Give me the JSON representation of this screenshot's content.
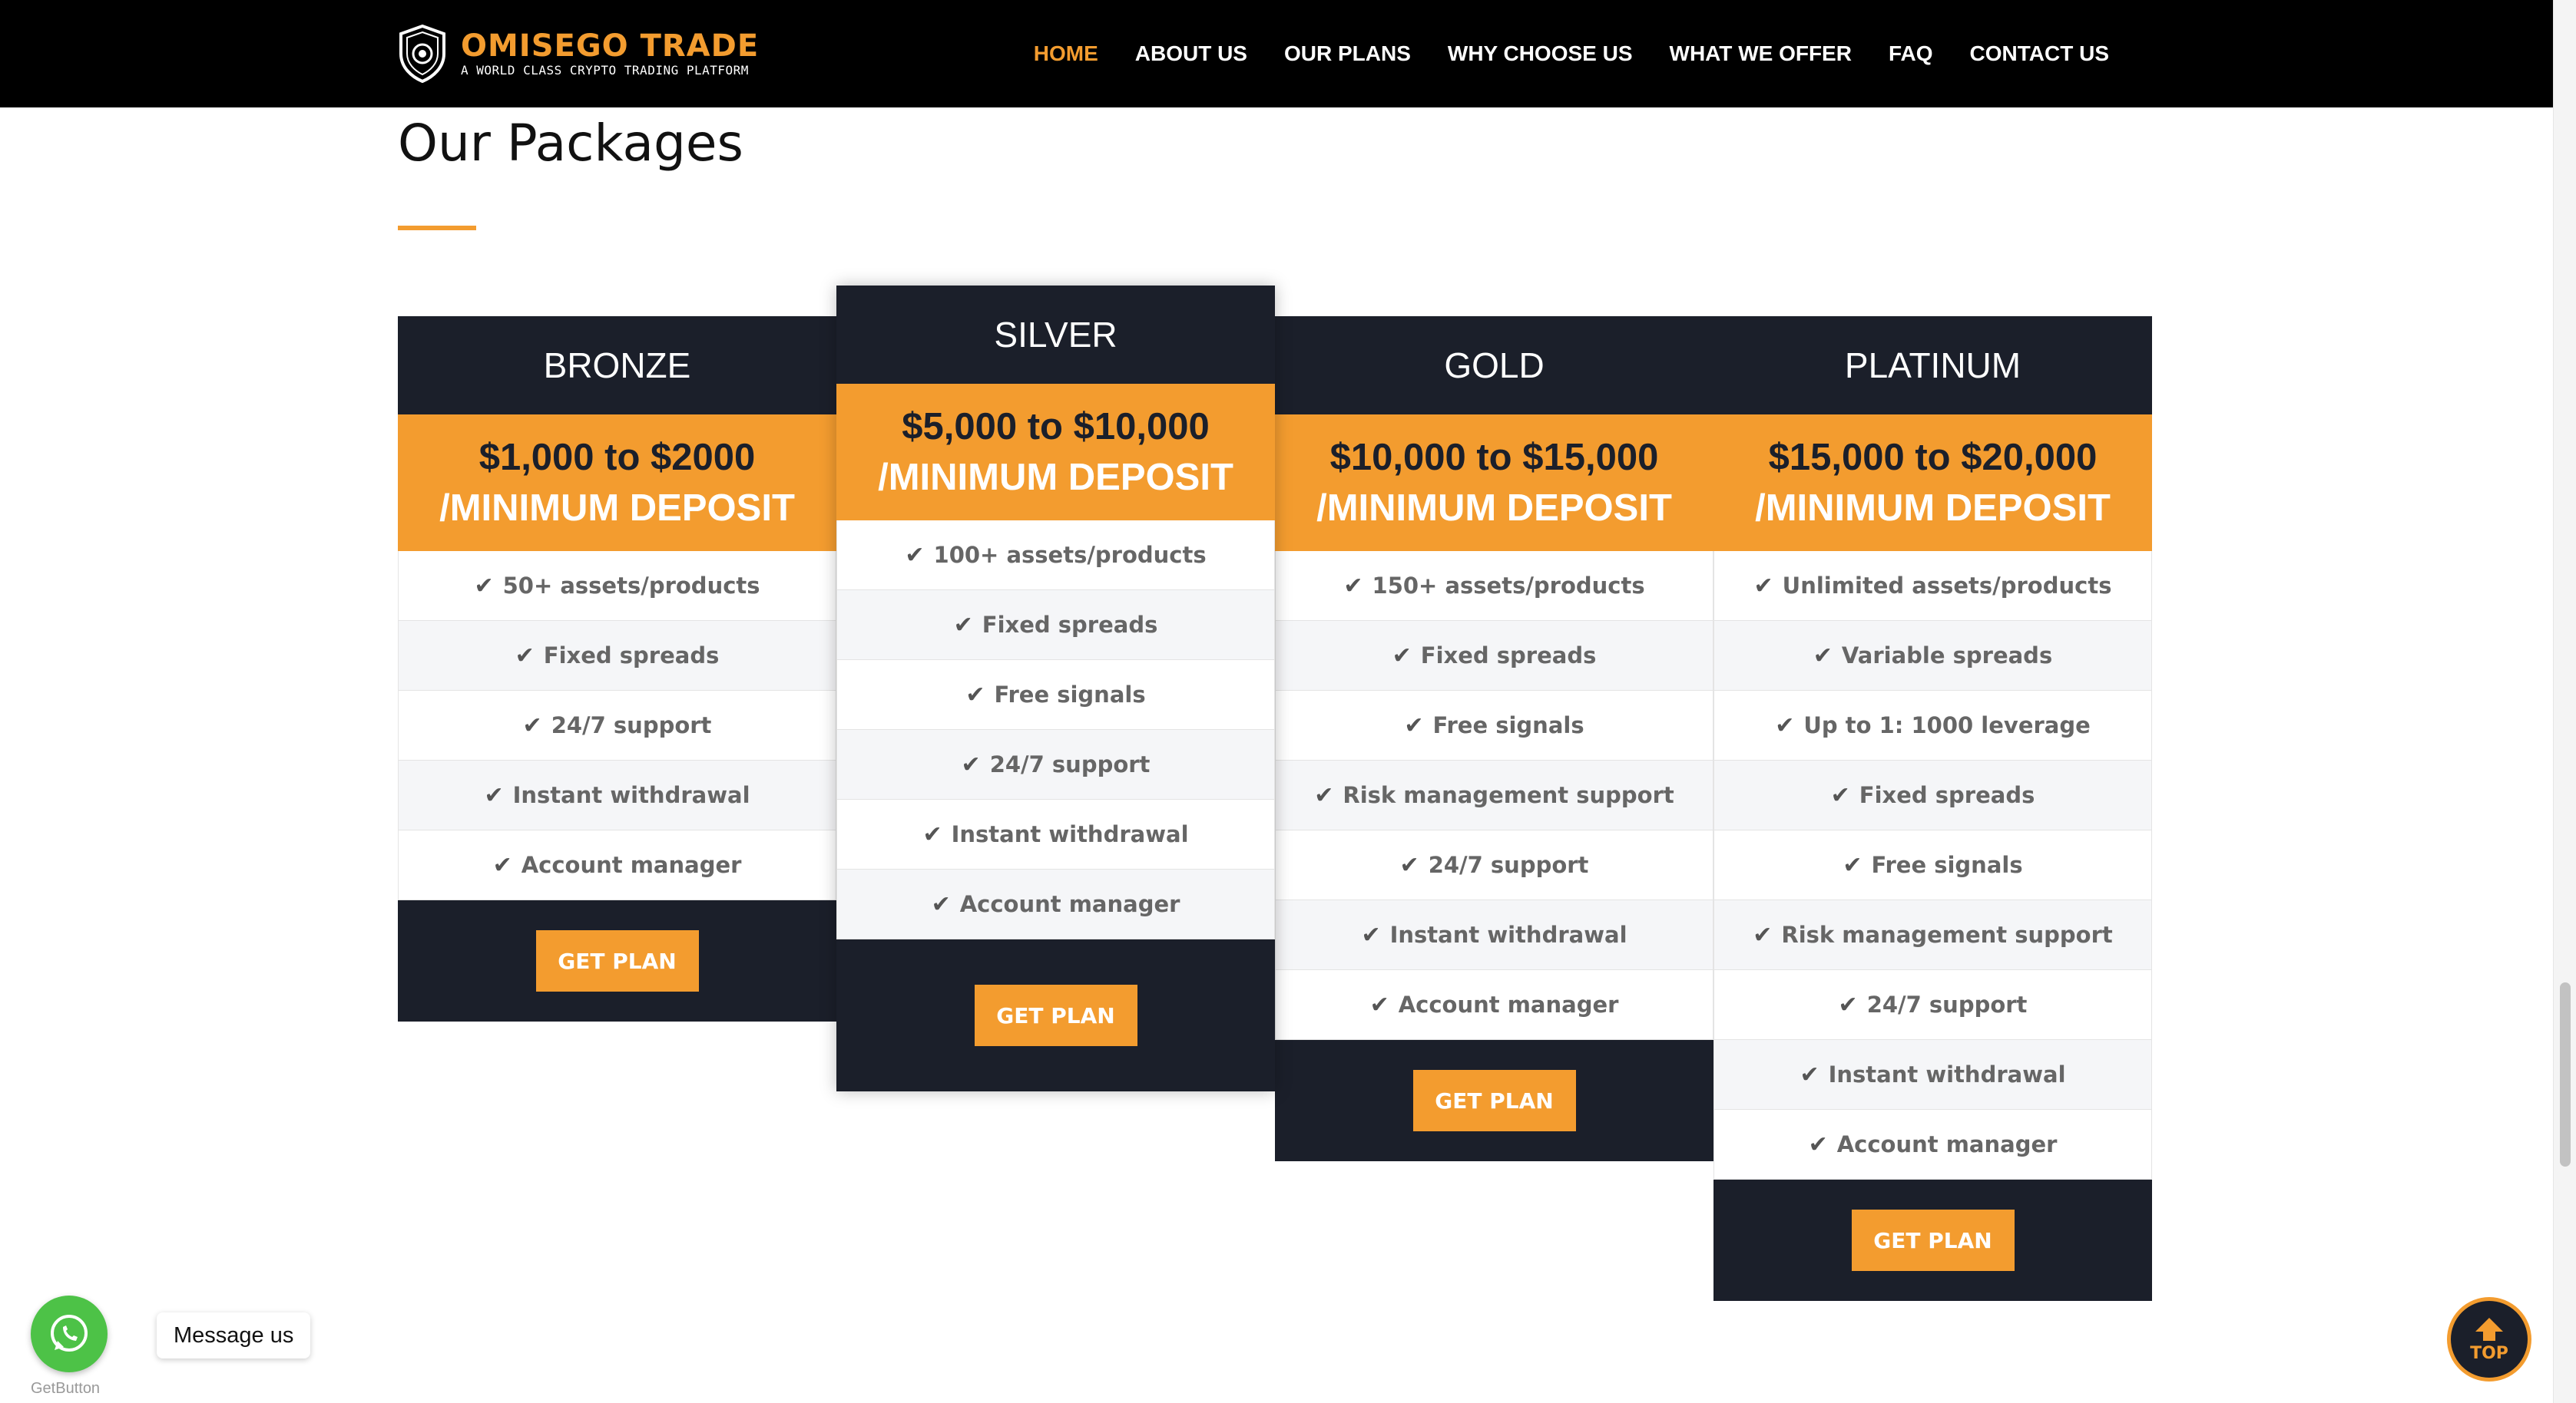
{
  "brand": {
    "name": "OMISEGO TRADE",
    "tagline": "A WORLD CLASS CRYPTO TRADING PLATFORM"
  },
  "nav": [
    {
      "label": "HOME",
      "active": true
    },
    {
      "label": "ABOUT US"
    },
    {
      "label": "OUR PLANS"
    },
    {
      "label": "WHY CHOOSE US"
    },
    {
      "label": "WHAT WE OFFER"
    },
    {
      "label": "FAQ"
    },
    {
      "label": "CONTACT US"
    }
  ],
  "section": {
    "title": "Our Packages"
  },
  "plans": [
    {
      "name": "BRONZE",
      "range": "$1,000 to $2000",
      "sub": "/MINIMUM DEPOSIT",
      "features": [
        "50+ assets/products",
        "Fixed spreads",
        "24/7 support",
        "Instant withdrawal",
        "Account manager"
      ],
      "button": "GET PLAN"
    },
    {
      "name": "SILVER",
      "range": "$5,000 to $10,000",
      "sub": "/MINIMUM DEPOSIT",
      "features": [
        "100+ assets/products",
        "Fixed spreads",
        "Free signals",
        "24/7 support",
        "Instant withdrawal",
        "Account manager"
      ],
      "button": "GET PLAN"
    },
    {
      "name": "GOLD",
      "range": "$10,000 to $15,000",
      "sub": "/MINIMUM DEPOSIT",
      "features": [
        "150+ assets/products",
        "Fixed spreads",
        "Free signals",
        "Risk management support",
        "24/7 support",
        "Instant withdrawal",
        "Account manager"
      ],
      "button": "GET PLAN"
    },
    {
      "name": "PLATINUM",
      "range": "$15,000 to $20,000",
      "sub": "/MINIMUM DEPOSIT",
      "features": [
        "Unlimited assets/products",
        "Variable spreads",
        "Up to 1: 1000 leverage",
        "Fixed spreads",
        "Free signals",
        "Risk management support",
        "24/7 support",
        "Instant withdrawal",
        "Account manager"
      ],
      "button": "GET PLAN"
    }
  ],
  "widgets": {
    "whatsapp_label": "Message us",
    "getbutton": "GetButton",
    "top_label": "TOP"
  },
  "colors": {
    "accent": "#f39c2f",
    "dark": "#1b1f2a",
    "whatsapp": "#4dc247"
  }
}
